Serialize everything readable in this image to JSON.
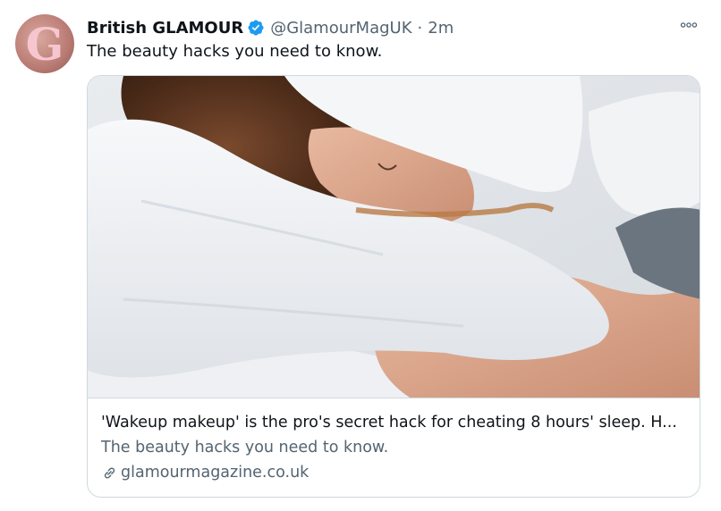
{
  "tweet": {
    "avatar_letter": "G",
    "author_name": "British GLAMOUR",
    "handle": "@GlamourMagUK",
    "separator": "·",
    "time": "2m",
    "text": "The beauty hacks you need to know.",
    "verified_icon": "verified-badge-icon",
    "more_icon": "more-options-icon"
  },
  "card": {
    "image_alt": "woman sleeping on white pillow",
    "title": "'Wakeup makeup' is the pro's secret hack for cheating 8 hours' sleep. H...",
    "description": "The beauty hacks you need to know.",
    "domain": "glamourmagazine.co.uk",
    "link_icon": "link-icon"
  },
  "colors": {
    "verified_blue": "#1d9bf0",
    "secondary_text": "#536471",
    "border": "#cfd9de",
    "avatar_letter_pink": "#f6c6d0"
  }
}
